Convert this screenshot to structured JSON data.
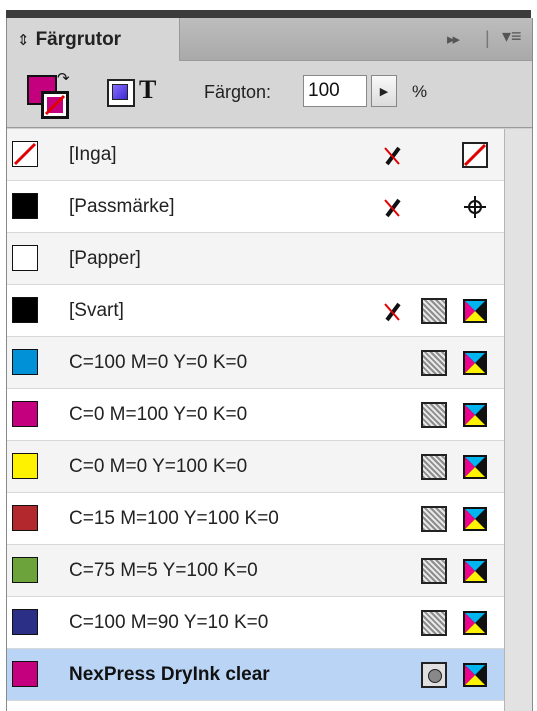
{
  "panel": {
    "title": "Färgrutor",
    "tab_arrow": "⇕",
    "fast_forward": "▸▸",
    "menu_glyph": "▾≡"
  },
  "toolbar": {
    "tint_label": "Färgton:",
    "tint_value": "100",
    "tint_unit": "%",
    "text_format_glyph": "T"
  },
  "colors": {
    "magenta": "#c4007e",
    "cyan": "#0091d6",
    "yellow": "#fff200",
    "red": "#b3282d",
    "green": "#6ca33a",
    "navy": "#2b2f86",
    "black": "#000000",
    "selection": "#b9d4f5"
  },
  "swatches": [
    {
      "name": "[Inga]",
      "color": "none",
      "lock": true,
      "type_icon": "none-icon"
    },
    {
      "name": "[Passmärke]",
      "color": "#000000",
      "lock": true,
      "type_icon": "registration-icon"
    },
    {
      "name": "[Papper]",
      "color": "#ffffff",
      "lock": false,
      "type_icon": ""
    },
    {
      "name": "[Svart]",
      "color": "#000000",
      "lock": true,
      "type_icon": "process-cmyk"
    },
    {
      "name": "C=100 M=0 Y=0 K=0",
      "color": "#0091d6",
      "lock": false,
      "type_icon": "process-cmyk"
    },
    {
      "name": "C=0 M=100 Y=0 K=0",
      "color": "#c4007e",
      "lock": false,
      "type_icon": "process-cmyk"
    },
    {
      "name": "C=0 M=0 Y=100 K=0",
      "color": "#fff200",
      "lock": false,
      "type_icon": "process-cmyk"
    },
    {
      "name": "C=15 M=100 Y=100 K=0",
      "color": "#b3282d",
      "lock": false,
      "type_icon": "process-cmyk"
    },
    {
      "name": "C=75 M=5 Y=100 K=0",
      "color": "#6ca33a",
      "lock": false,
      "type_icon": "process-cmyk"
    },
    {
      "name": "C=100 M=90 Y=10 K=0",
      "color": "#2b2f86",
      "lock": false,
      "type_icon": "process-cmyk"
    },
    {
      "name": "NexPress DryInk clear",
      "color": "#c4007e",
      "lock": false,
      "type_icon": "spot-cmyk",
      "selected": true
    }
  ]
}
